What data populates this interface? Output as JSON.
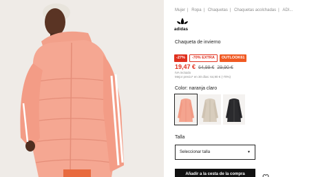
{
  "breadcrumb": [
    "Mujer",
    "Ropa",
    "Chaquetas",
    "Chaquetas acolchadas",
    "ADI..."
  ],
  "brand": {
    "name": "adidas"
  },
  "product": {
    "name": "Chaqueta de invierno"
  },
  "badges": {
    "discount": "-27%",
    "extra": "-70% EXTRA",
    "code": "OUTLOOK61"
  },
  "price": {
    "current": "19,47 €",
    "original_1": "64,99 €",
    "original_2": "29,90 €",
    "vat_note": "IVA incluido",
    "best_price_note": "Mejor precio* en 30 días: 64,90 € (-70%)"
  },
  "color": {
    "label": "Color: naranja claro",
    "swatches": [
      {
        "name": "naranja claro",
        "hex": "#f4a48f",
        "selected": true
      },
      {
        "name": "beige",
        "hex": "#d8cdbd",
        "selected": false
      },
      {
        "name": "negro",
        "hex": "#2b2b2e",
        "selected": false
      }
    ]
  },
  "size": {
    "label": "Talla",
    "placeholder": "Seleccionar talla"
  },
  "cart": {
    "label": "Añadir a la cesta de la compra"
  },
  "colors": {
    "accent_red": "#e0301e",
    "badge_orange": "#f05a23",
    "jacket_peach": "#f4a48f"
  }
}
